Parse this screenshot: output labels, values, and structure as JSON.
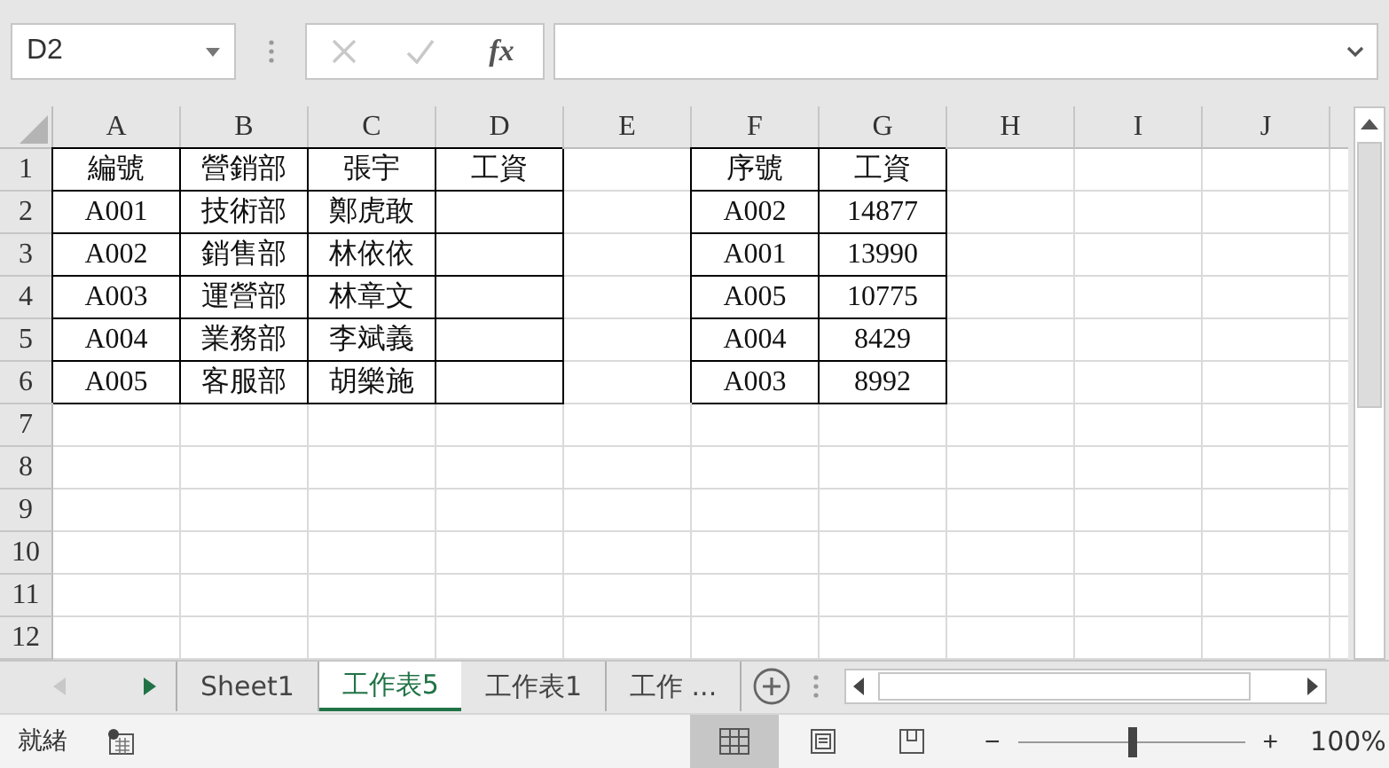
{
  "formula_bar": {
    "name_box": "D2",
    "function_button": "fx",
    "cancel_enabled": false,
    "enter_enabled": false
  },
  "grid": {
    "columns": [
      "A",
      "B",
      "C",
      "D",
      "E",
      "F",
      "G",
      "H",
      "I",
      "J"
    ],
    "rows": [
      {
        "number": "1",
        "cells": [
          {
            "text": "編號",
            "bordered": true
          },
          {
            "text": "營銷部",
            "bordered": true
          },
          {
            "text": "張宇",
            "bordered": true
          },
          {
            "text": "工資",
            "bordered": true
          },
          {
            "bordered": false
          },
          {
            "text": "序號",
            "bordered": true
          },
          {
            "text": "工資",
            "bordered": true
          }
        ]
      },
      {
        "number": "2",
        "cells": [
          {
            "text": "A001",
            "bordered": true
          },
          {
            "text": "技術部",
            "bordered": true
          },
          {
            "text": "鄭虎敢",
            "bordered": true
          },
          {
            "bordered": true
          },
          {
            "bordered": false
          },
          {
            "text": "A002",
            "bordered": true
          },
          {
            "text": "14877",
            "bordered": true
          }
        ]
      },
      {
        "number": "3",
        "cells": [
          {
            "text": "A002",
            "bordered": true
          },
          {
            "text": "銷售部",
            "bordered": true
          },
          {
            "text": "林依依",
            "bordered": true
          },
          {
            "bordered": true
          },
          {
            "bordered": false
          },
          {
            "text": "A001",
            "bordered": true
          },
          {
            "text": "13990",
            "bordered": true
          }
        ]
      },
      {
        "number": "4",
        "cells": [
          {
            "text": "A003",
            "bordered": true
          },
          {
            "text": "運營部",
            "bordered": true
          },
          {
            "text": "林章文",
            "bordered": true
          },
          {
            "bordered": true
          },
          {
            "bordered": false
          },
          {
            "text": "A005",
            "bordered": true
          },
          {
            "text": "10775",
            "bordered": true
          }
        ]
      },
      {
        "number": "5",
        "cells": [
          {
            "text": "A004",
            "bordered": true
          },
          {
            "text": "業務部",
            "bordered": true
          },
          {
            "text": "李斌義",
            "bordered": true
          },
          {
            "bordered": true
          },
          {
            "bordered": false
          },
          {
            "text": "A004",
            "bordered": true
          },
          {
            "text": "8429",
            "bordered": true
          }
        ]
      },
      {
        "number": "6",
        "cells": [
          {
            "text": "A005",
            "bordered": true
          },
          {
            "text": "客服部",
            "bordered": true
          },
          {
            "text": "胡樂施",
            "bordered": true
          },
          {
            "bordered": true
          },
          {
            "bordered": false
          },
          {
            "text": "A003",
            "bordered": true
          },
          {
            "text": "8992",
            "bordered": true
          }
        ]
      },
      {
        "number": "7"
      },
      {
        "number": "8"
      },
      {
        "number": "9"
      },
      {
        "number": "10"
      },
      {
        "number": "11"
      },
      {
        "number": "12"
      }
    ]
  },
  "sheet_nav": {
    "previous_enabled": false,
    "next_enabled": true
  },
  "tabs": [
    {
      "label": "Sheet1",
      "selected": false
    },
    {
      "label": "工作表5",
      "selected": true
    },
    {
      "label": "工作表1",
      "selected": false
    },
    {
      "label": "工作 ...",
      "selected": false
    }
  ],
  "status_bar": {
    "status": "就緒",
    "views": [
      {
        "kind": "normal",
        "selected": true
      },
      {
        "kind": "page-layout",
        "selected": false
      },
      {
        "kind": "page-break",
        "selected": false
      }
    ],
    "zoom": {
      "zoom_out": "−",
      "zoom_in": "+",
      "level": 0.5,
      "reading": "100%"
    }
  }
}
